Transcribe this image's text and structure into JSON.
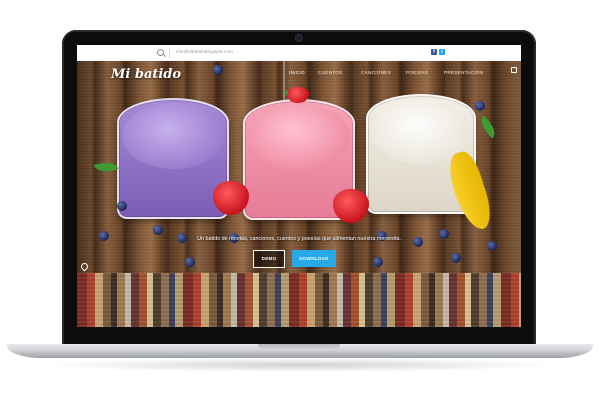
{
  "topbar": {
    "email": "info@elbatidoblogspot.com",
    "social": [
      "facebook-icon",
      "twitter-icon"
    ]
  },
  "hero": {
    "logo": "Mi batido",
    "nav": [
      "INICIO",
      "CUENTOS",
      "CANCIONES",
      "POESÍAS",
      "PRESENTACIÓN"
    ],
    "tagline": "Un batido de recetas, canciones, cuentos y poesías que alimentan nuestra merienda.",
    "buttons": {
      "demo": "DEMO",
      "download": "DOWNLOAD"
    }
  },
  "colors": {
    "accent": "#29a8e8",
    "topbar_bg": "#ffffff",
    "laptop_bezel": "#0c0c0d",
    "facebook": "#3b5998",
    "twitter": "#1da1f2"
  }
}
